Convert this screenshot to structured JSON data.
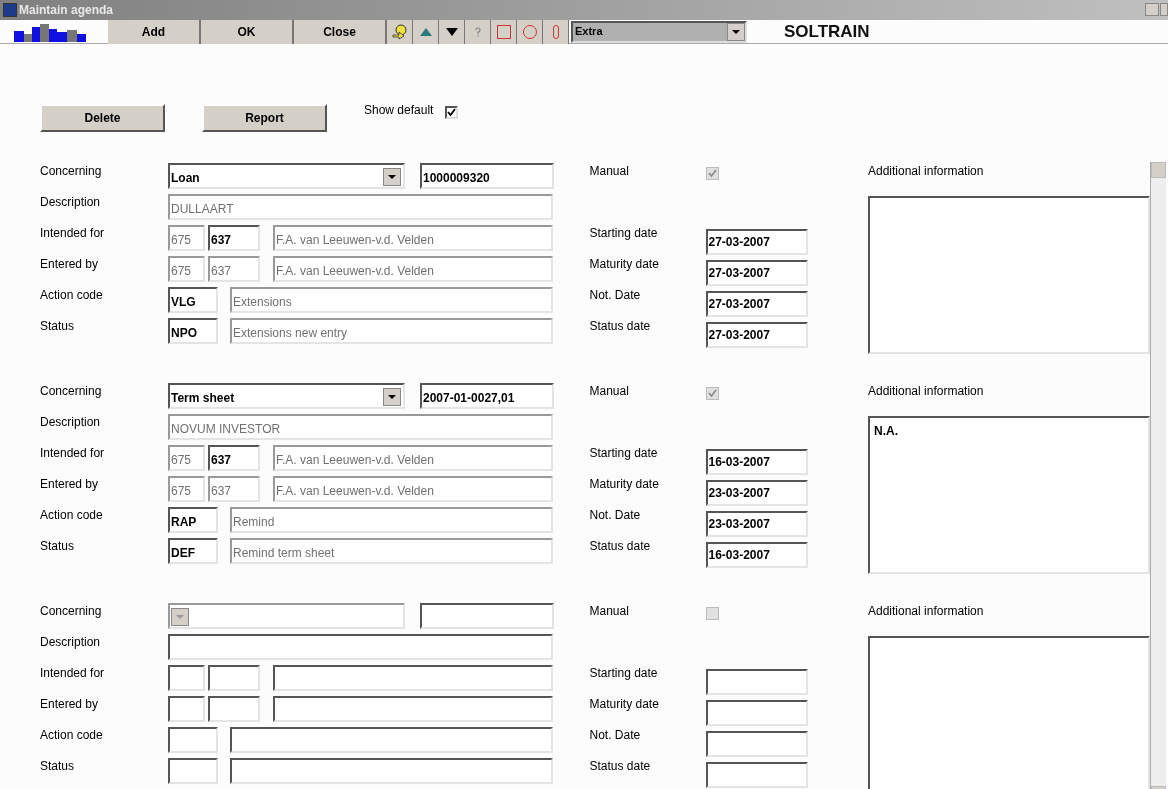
{
  "window": {
    "title": "Maintain agenda"
  },
  "toolbar": {
    "buttons": [
      "Add",
      "OK",
      "Close"
    ],
    "menu": "Extra",
    "company": "SOLTRAIN"
  },
  "actions": {
    "buttons": [
      "Delete",
      "Report"
    ],
    "show_default": {
      "label": "Show default",
      "checked": true
    }
  },
  "sections": [
    {
      "rows": [
        {
          "kind": "concerning",
          "label": "Concerning",
          "fields": [
            {
              "value": "Loan",
              "disabled": false
            },
            {
              "value": "1000009320",
              "disabled": false
            }
          ]
        },
        {
          "kind": "description",
          "label": "Description",
          "fields": [
            {
              "value": "DULLAART",
              "disabled": true
            }
          ]
        },
        {
          "kind": "person",
          "label": "Intended for",
          "fields": [
            {
              "value": "675",
              "disabled": true
            },
            {
              "value": "637",
              "disabled": false
            },
            {
              "value": "F.A. van Leeuwen-v.d. Velden",
              "disabled": true
            }
          ]
        },
        {
          "kind": "person",
          "label": "Entered by",
          "fields": [
            {
              "value": "675",
              "disabled": true
            },
            {
              "value": "637",
              "disabled": true
            },
            {
              "value": "F.A. van Leeuwen-v.d. Velden",
              "disabled": true
            }
          ]
        },
        {
          "kind": "code",
          "label": "Action code",
          "fields": [
            {
              "value": "VLG",
              "disabled": false
            },
            {
              "value": "Extensions",
              "disabled": true
            }
          ]
        },
        {
          "kind": "code",
          "label": "Status",
          "fields": [
            {
              "value": "NPO",
              "disabled": false
            },
            {
              "value": "Extensions new entry",
              "disabled": true
            }
          ]
        }
      ],
      "manual": {
        "label": "Manual",
        "checked": true
      },
      "dates": [
        {
          "label": "Starting date",
          "value": "27-03-2007"
        },
        {
          "label": "Maturity date",
          "value": "27-03-2007"
        },
        {
          "label": "Not. Date",
          "value": "27-03-2007"
        },
        {
          "label": "Status date",
          "value": "27-03-2007"
        }
      ],
      "additional": {
        "label": "Additional information"
      }
    },
    {
      "rows": [
        {
          "kind": "concerning",
          "label": "Concerning",
          "fields": [
            {
              "value": "Term sheet",
              "disabled": false
            },
            {
              "value": "2007-01-0027,01",
              "disabled": false
            }
          ]
        },
        {
          "kind": "description",
          "label": "Description",
          "fields": [
            {
              "value": "NOVUM INVESTOR",
              "disabled": true
            }
          ]
        },
        {
          "kind": "person",
          "label": "Intended for",
          "fields": [
            {
              "value": "675",
              "disabled": true
            },
            {
              "value": "637",
              "disabled": false
            },
            {
              "value": "F.A. van Leeuwen-v.d. Velden",
              "disabled": true
            }
          ]
        },
        {
          "kind": "person",
          "label": "Entered by",
          "fields": [
            {
              "value": "675",
              "disabled": true
            },
            {
              "value": "637",
              "disabled": true
            },
            {
              "value": "F.A. van Leeuwen-v.d. Velden",
              "disabled": true
            }
          ]
        },
        {
          "kind": "code",
          "label": "Action code",
          "fields": [
            {
              "value": "RAP",
              "disabled": false
            },
            {
              "value": "Remind",
              "disabled": true
            }
          ]
        },
        {
          "kind": "code",
          "label": "Status",
          "fields": [
            {
              "value": "DEF",
              "disabled": false
            },
            {
              "value": "Remind term sheet",
              "disabled": true
            }
          ]
        }
      ],
      "manual": {
        "label": "Manual",
        "checked": true
      },
      "dates": [
        {
          "label": "Starting date",
          "value": "16-03-2007"
        },
        {
          "label": "Maturity date",
          "value": "23-03-2007"
        },
        {
          "label": "Not. Date",
          "value": "23-03-2007"
        },
        {
          "label": "Status date",
          "value": "16-03-2007"
        }
      ],
      "additional": {
        "label": "Additional information",
        "value": "N.A."
      }
    },
    {
      "rows": [
        {
          "kind": "concerning",
          "label": "Concerning",
          "fields": [
            {
              "disabled": true
            },
            {
              "disabled": false
            }
          ]
        },
        {
          "kind": "description",
          "label": "Description",
          "fields": [
            {
              "disabled": false
            }
          ]
        },
        {
          "kind": "person",
          "label": "Intended for",
          "fields": [
            {
              "disabled": false
            },
            {
              "disabled": false
            },
            {
              "disabled": false
            }
          ]
        },
        {
          "kind": "person",
          "label": "Entered by",
          "fields": [
            {
              "disabled": false
            },
            {
              "disabled": false
            },
            {
              "disabled": false
            }
          ]
        },
        {
          "kind": "code",
          "label": "Action code",
          "fields": [
            {
              "disabled": false
            },
            {
              "disabled": false
            }
          ]
        },
        {
          "kind": "code",
          "label": "Status",
          "fields": [
            {
              "disabled": false
            },
            {
              "disabled": false
            }
          ]
        }
      ],
      "manual": {
        "label": "Manual",
        "checked": false
      },
      "dates": [
        {
          "label": "Starting date"
        },
        {
          "label": "Maturity date"
        },
        {
          "label": "Not. Date"
        },
        {
          "label": "Status date"
        }
      ],
      "additional": {
        "label": "Additional information"
      }
    }
  ]
}
